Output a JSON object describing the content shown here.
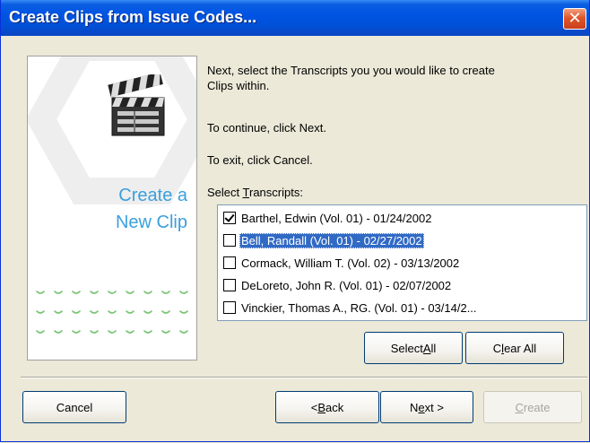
{
  "window": {
    "title": "Create Clips from Issue Codes...",
    "close_glyph": "✕"
  },
  "banner": {
    "title_line1": "Create a",
    "title_line2": "New Clip",
    "icon": "clapperboard-icon"
  },
  "instructions": {
    "line1": "Next, select the Transcripts you you would like to create",
    "line2": "Clips within.",
    "continue": "To continue, click Next.",
    "exit": "To exit, click Cancel."
  },
  "transcripts": {
    "label_prefix": "Select ",
    "label_mnemonic": "T",
    "label_rest": "ranscripts:",
    "items": [
      {
        "label": "Barthel, Edwin (Vol. 01) - 01/24/2002",
        "checked": true,
        "selected": false
      },
      {
        "label": "Bell, Randall (Vol. 01) - 02/27/2002",
        "checked": false,
        "selected": true
      },
      {
        "label": "Cormack, William T. (Vol. 02) - 03/13/2002",
        "checked": false,
        "selected": false
      },
      {
        "label": "DeLoreto, John R. (Vol. 01) - 02/07/2002",
        "checked": false,
        "selected": false
      },
      {
        "label": "Vinckier, Thomas A., RG. (Vol. 01) - 03/14/2...",
        "checked": false,
        "selected": false
      }
    ]
  },
  "buttons": {
    "select_all_prefix": "Select ",
    "select_all_mnemonic": "A",
    "select_all_rest": "ll",
    "clear_all_prefix": "C",
    "clear_all_mnemonic": "l",
    "clear_all_rest": "ear All",
    "cancel": "Cancel",
    "back_prefix": "< ",
    "back_mnemonic": "B",
    "back_rest": "ack",
    "next_prefix": "N",
    "next_mnemonic": "e",
    "next_rest": "xt >",
    "create_mnemonic": "C",
    "create_rest": "reate"
  },
  "colors": {
    "titlebar": "#0054e3",
    "selection": "#316ac5",
    "banner_text": "#3aa0dc",
    "dots": "#7cc576"
  }
}
